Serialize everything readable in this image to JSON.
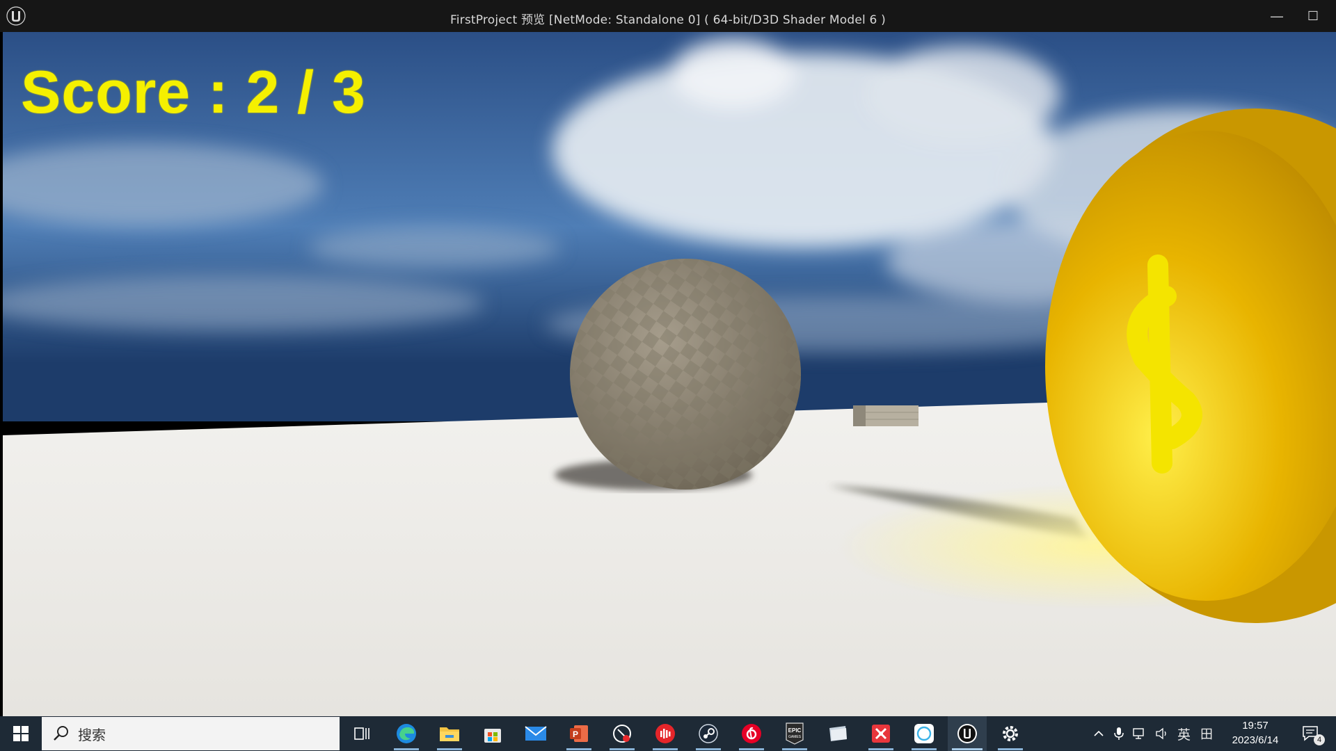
{
  "window": {
    "title": "FirstProject 预览 [NetMode: Standalone 0]  ( 64-bit/D3D Shader Model 6 )",
    "minimize_glyph": "—",
    "maximize_glyph": "☐"
  },
  "hud": {
    "score_text": "Score : 2 / 3",
    "score_color": "#f5f000"
  },
  "taskbar": {
    "search_placeholder": "搜索",
    "apps": [
      {
        "name": "task-view-icon"
      },
      {
        "name": "edge-icon"
      },
      {
        "name": "file-explorer-icon"
      },
      {
        "name": "microsoft-store-icon"
      },
      {
        "name": "mail-icon"
      },
      {
        "name": "powerpoint-icon"
      },
      {
        "name": "screen-recorder-icon"
      },
      {
        "name": "audio-app-icon"
      },
      {
        "name": "steam-icon"
      },
      {
        "name": "netease-music-icon"
      },
      {
        "name": "epic-games-icon"
      },
      {
        "name": "folder-app-icon"
      },
      {
        "name": "xmind-icon"
      },
      {
        "name": "messenger-icon"
      },
      {
        "name": "unreal-engine-icon"
      },
      {
        "name": "settings-icon"
      }
    ],
    "epic_label": "EPIC\nGAMES",
    "tray": {
      "ime_label": "英",
      "layout_label": "田"
    },
    "clock": {
      "time": "19:57",
      "date": "2023/6/14"
    },
    "notification_count": "4"
  },
  "colors": {
    "titlebar": "#161616",
    "taskbar": "#1e2a36",
    "coin": "#f0c400"
  }
}
